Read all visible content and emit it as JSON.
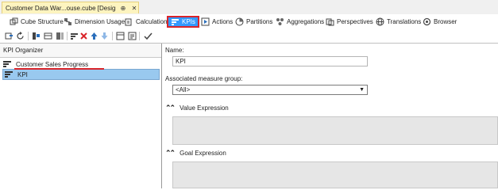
{
  "document_tab": {
    "title": "Customer Data War...ouse.cube [Design]*",
    "pin_glyph": "⊕",
    "close_glyph": "✕"
  },
  "designer_tabs": [
    {
      "label": "Cube Structure",
      "icon": "cube-structure-icon",
      "active": false
    },
    {
      "label": "Dimension Usage",
      "icon": "dimension-usage-icon",
      "active": false
    },
    {
      "label": "Calculations",
      "icon": "calculations-icon",
      "active": false
    },
    {
      "label": "KPIs",
      "icon": "kpis-icon",
      "active": true
    },
    {
      "label": "Actions",
      "icon": "actions-icon",
      "active": false
    },
    {
      "label": "Partitions",
      "icon": "partitions-icon",
      "active": false
    },
    {
      "label": "Aggregations",
      "icon": "aggregations-icon",
      "active": false
    },
    {
      "label": "Perspectives",
      "icon": "perspectives-icon",
      "active": false
    },
    {
      "label": "Translations",
      "icon": "translations-icon",
      "active": false
    },
    {
      "label": "Browser",
      "icon": "browser-icon",
      "active": false
    }
  ],
  "toolbar": {
    "icons": [
      "process-icon",
      "refresh-icon",
      "form-view-icon",
      "calculation-properties-icon",
      "template-icon",
      "dimension-icon",
      "delete-icon",
      "move-up-icon",
      "move-down-icon",
      "form-layout-icon",
      "script-view-icon",
      "check-syntax-icon"
    ]
  },
  "kpi_organizer": {
    "header": "KPI Organizer",
    "items": [
      {
        "label": "Customer Sales Progress",
        "selected": false
      },
      {
        "label": "KPI",
        "selected": true
      }
    ]
  },
  "form": {
    "name_label": "Name:",
    "name_value": "KPI",
    "measure_group_label": "Associated measure group:",
    "measure_group_value": "<All>",
    "value_expression_label": "Value Expression",
    "goal_expression_label": "Goal Expression"
  },
  "colors": {
    "active_tab_background": "#3399ff",
    "highlight_border": "#d9242a",
    "selected_row": "#99c9ef",
    "document_tab_background": "#fdf4bf"
  }
}
